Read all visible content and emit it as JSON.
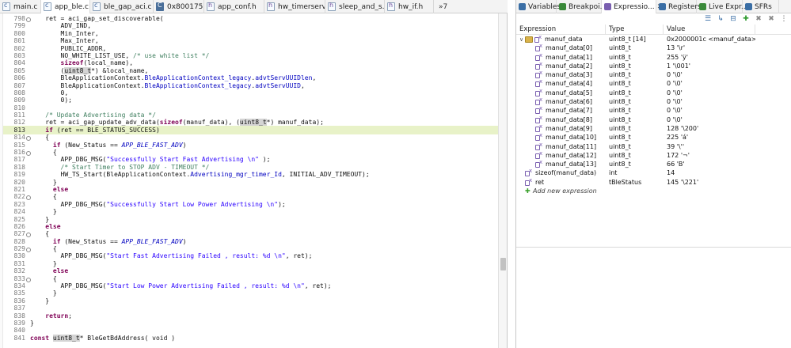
{
  "editor": {
    "tabs": [
      {
        "label": "main.c",
        "icon": "c-file-icon",
        "kind": "c"
      },
      {
        "label": "app_ble.c",
        "icon": "c-file-icon",
        "kind": "c",
        "active": true
      },
      {
        "label": "ble_gap_aci.c",
        "icon": "c-file-icon",
        "kind": "c"
      },
      {
        "label": "0x8001750",
        "icon": "disassembly-icon",
        "kind": "img"
      },
      {
        "label": "app_conf.h",
        "icon": "h-file-icon",
        "kind": "h"
      },
      {
        "label": "hw_timerserv...",
        "icon": "h-file-icon",
        "kind": "h"
      },
      {
        "label": "sleep_and_s...",
        "icon": "h-file-icon",
        "kind": "h"
      },
      {
        "label": "hw_if.h",
        "icon": "h-file-icon",
        "kind": "h"
      }
    ],
    "overflow_label": "»7",
    "current_line": 813,
    "lines": [
      {
        "n": "798",
        "t": "    ret = aci_gap_set_discoverable("
      },
      {
        "n": "799",
        "t": "        ADV_IND,"
      },
      {
        "n": "800",
        "t": "        Min_Inter,"
      },
      {
        "n": "801",
        "t": "        Max_Inter,"
      },
      {
        "n": "802",
        "t": "        PUBLIC_ADDR,"
      },
      {
        "n": "803",
        "t": "        NO_WHITE_LIST_USE, /* use white list */"
      },
      {
        "n": "804",
        "t": "        sizeof(local_name),"
      },
      {
        "n": "805",
        "t": "        (uint8_t*) &local_name,"
      },
      {
        "n": "806",
        "t": "        BleApplicationContext.BleApplicationContext_legacy.advtServUUIDlen,"
      },
      {
        "n": "807",
        "t": "        BleApplicationContext.BleApplicationContext_legacy.advtServUUID,"
      },
      {
        "n": "808",
        "t": "        0,"
      },
      {
        "n": "809",
        "t": "        0);"
      },
      {
        "n": "810",
        "t": ""
      },
      {
        "n": "811",
        "t": "    /* Update Advertising data */"
      },
      {
        "n": "812",
        "t": "    ret = aci_gap_update_adv_data(sizeof(manuf_data), (uint8_t*) manuf_data);"
      },
      {
        "n": "813",
        "t": "    if (ret == BLE_STATUS_SUCCESS)"
      },
      {
        "n": "814",
        "t": "    {"
      },
      {
        "n": "815",
        "t": "      if (New_Status == APP_BLE_FAST_ADV)"
      },
      {
        "n": "816",
        "t": "      {"
      },
      {
        "n": "817",
        "t": "        APP_DBG_MSG(\"Successfully Start Fast Advertising \\n\" );"
      },
      {
        "n": "818",
        "t": "        /* Start Timer to STOP ADV - TIMEOUT */"
      },
      {
        "n": "819",
        "t": "        HW_TS_Start(BleApplicationContext.Advertising_mgr_timer_Id, INITIAL_ADV_TIMEOUT);"
      },
      {
        "n": "820",
        "t": "      }"
      },
      {
        "n": "821",
        "t": "      else"
      },
      {
        "n": "822",
        "t": "      {"
      },
      {
        "n": "823",
        "t": "        APP_DBG_MSG(\"Successfully Start Low Power Advertising \\n\");"
      },
      {
        "n": "824",
        "t": "      }"
      },
      {
        "n": "825",
        "t": "    }"
      },
      {
        "n": "826",
        "t": "    else"
      },
      {
        "n": "827",
        "t": "    {"
      },
      {
        "n": "828",
        "t": "      if (New_Status == APP_BLE_FAST_ADV)"
      },
      {
        "n": "829",
        "t": "      {"
      },
      {
        "n": "830",
        "t": "        APP_DBG_MSG(\"Start Fast Advertising Failed , result: %d \\n\", ret);"
      },
      {
        "n": "831",
        "t": "      }"
      },
      {
        "n": "832",
        "t": "      else"
      },
      {
        "n": "833",
        "t": "      {"
      },
      {
        "n": "834",
        "t": "        APP_DBG_MSG(\"Start Low Power Advertising Failed , result: %d \\n\", ret);"
      },
      {
        "n": "835",
        "t": "      }"
      },
      {
        "n": "836",
        "t": "    }"
      },
      {
        "n": "837",
        "t": ""
      },
      {
        "n": "838",
        "t": "    return;"
      },
      {
        "n": "839",
        "t": "}"
      },
      {
        "n": "840",
        "t": ""
      },
      {
        "n": "841",
        "t": "const uint8_t* BleGetBdAddress( void )"
      }
    ]
  },
  "views": {
    "tabs": [
      {
        "label": "Variables",
        "icon": "variables-icon"
      },
      {
        "label": "Breakpoi...",
        "icon": "breakpoints-icon"
      },
      {
        "label": "Expressio...",
        "icon": "expressions-icon",
        "active": true,
        "closable": true
      },
      {
        "label": "Registers",
        "icon": "registers-icon"
      },
      {
        "label": "Live Expr...",
        "icon": "live-expressions-icon"
      },
      {
        "label": "SFRs",
        "icon": "sfrs-icon"
      }
    ],
    "close_glyph": "✕",
    "toolbar_icons": [
      "show-type-names-icon",
      "show-logical-structure-icon",
      "collapse-all-icon",
      "add-expression-icon",
      "remove-expression-icon",
      "remove-all-icon",
      "view-menu-icon"
    ],
    "toolbar_glyphs": [
      "☰",
      "↳",
      "⊟",
      "✚",
      "✖",
      "✖",
      "⋮"
    ],
    "columns": {
      "expression": "Expression",
      "type": "Type",
      "value": "Value"
    },
    "expressions": [
      {
        "expr": "manuf_data",
        "type": "uint8_t [14]",
        "value": "0x2000001c <manuf_data>",
        "level": 0,
        "expandable": true,
        "group": true
      },
      {
        "expr": "manuf_data[0]",
        "type": "uint8_t",
        "value": "13 '\\r'",
        "level": 1
      },
      {
        "expr": "manuf_data[1]",
        "type": "uint8_t",
        "value": "255 'ÿ'",
        "level": 1
      },
      {
        "expr": "manuf_data[2]",
        "type": "uint8_t",
        "value": "1 '\\001'",
        "level": 1
      },
      {
        "expr": "manuf_data[3]",
        "type": "uint8_t",
        "value": "0 '\\0'",
        "level": 1
      },
      {
        "expr": "manuf_data[4]",
        "type": "uint8_t",
        "value": "0 '\\0'",
        "level": 1
      },
      {
        "expr": "manuf_data[5]",
        "type": "uint8_t",
        "value": "0 '\\0'",
        "level": 1
      },
      {
        "expr": "manuf_data[6]",
        "type": "uint8_t",
        "value": "0 '\\0'",
        "level": 1
      },
      {
        "expr": "manuf_data[7]",
        "type": "uint8_t",
        "value": "0 '\\0'",
        "level": 1
      },
      {
        "expr": "manuf_data[8]",
        "type": "uint8_t",
        "value": "0 '\\0'",
        "level": 1
      },
      {
        "expr": "manuf_data[9]",
        "type": "uint8_t",
        "value": "128 '\\200'",
        "level": 1
      },
      {
        "expr": "manuf_data[10]",
        "type": "uint8_t",
        "value": "225 'á'",
        "level": 1
      },
      {
        "expr": "manuf_data[11]",
        "type": "uint8_t",
        "value": "39 '\\''",
        "level": 1
      },
      {
        "expr": "manuf_data[12]",
        "type": "uint8_t",
        "value": "172 '¬'",
        "level": 1
      },
      {
        "expr": "manuf_data[13]",
        "type": "uint8_t",
        "value": "66 'B'",
        "level": 1
      },
      {
        "expr": "sizeof(manuf_data)",
        "type": "int",
        "value": "14",
        "level": 0
      },
      {
        "expr": "ret",
        "type": "tBleStatus",
        "value": "145 '\\221'",
        "level": 0
      }
    ],
    "add_new_expression": "Add new expression",
    "colors": {
      "keyword": "#7f0055",
      "comment": "#3f7f5f",
      "string": "#2a00ff",
      "macro": "#0000c0",
      "current_line": "#e8f2c8"
    }
  }
}
